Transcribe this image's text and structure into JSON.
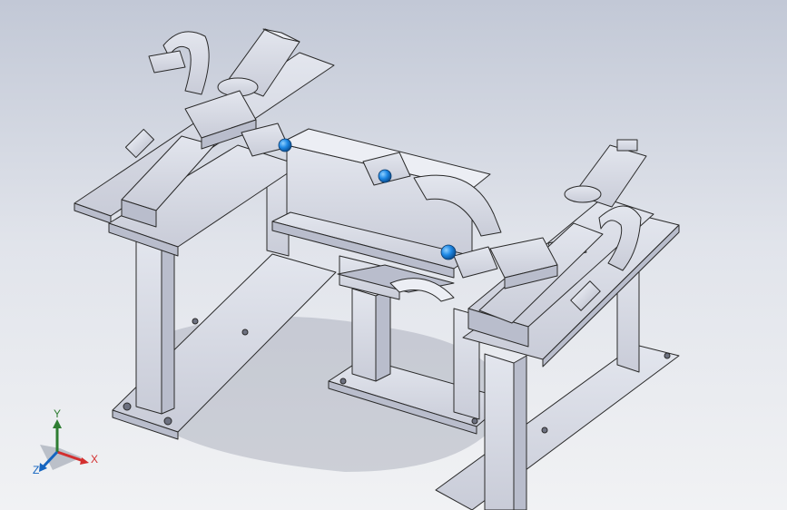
{
  "viewport": {
    "background_top": "#c2c8d6",
    "background_bottom": "#f1f2f4"
  },
  "model": {
    "part_color": "#d8dbe6",
    "part_shade": "#b9bdcc",
    "edge_color": "#2a2a2a",
    "ball_color": "#1e88e5"
  },
  "triad": {
    "x_label": "X",
    "y_label": "Y",
    "z_label": "Z",
    "x_color": "#d32f2f",
    "y_color": "#2e7d32",
    "z_color": "#1565c0"
  }
}
